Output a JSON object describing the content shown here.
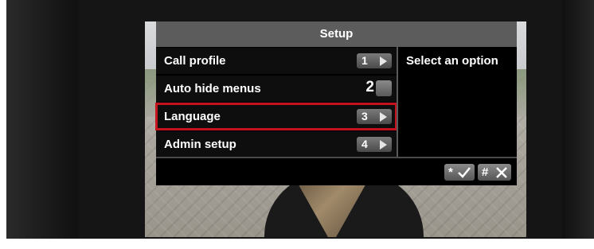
{
  "setup": {
    "title": "Setup"
  },
  "menu": {
    "items": [
      {
        "label": "Call profile",
        "key": "1"
      },
      {
        "label": "Auto hide menus",
        "key": "2"
      },
      {
        "label": "Language",
        "key": "3"
      },
      {
        "label": "Admin setup",
        "key": "4"
      }
    ],
    "selected_index": 2
  },
  "hint": {
    "text": "Select an option"
  },
  "softkeys": {
    "confirm_key": "*",
    "cancel_key": "#"
  },
  "colors": {
    "highlight": "#c4121f",
    "title_bar": "#5c5c5c",
    "panel": "#000000"
  }
}
